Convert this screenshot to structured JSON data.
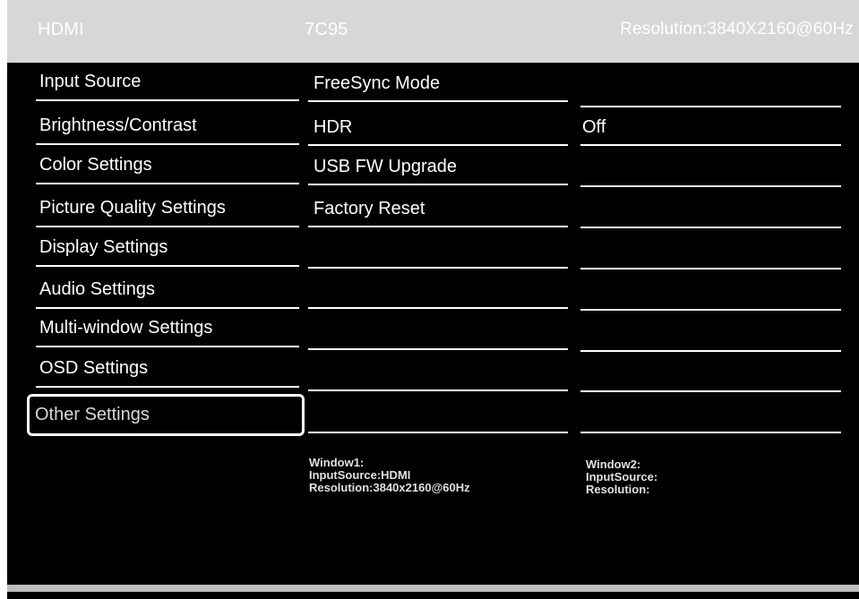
{
  "header": {
    "input_source": "HDMI",
    "model": "7C95",
    "resolution": "Resolution:3840X2160@60Hz"
  },
  "menu": {
    "items": [
      {
        "label": "Input Source"
      },
      {
        "label": "Brightness/Contrast"
      },
      {
        "label": "Color Settings"
      },
      {
        "label": "Picture Quality Settings"
      },
      {
        "label": "Display Settings"
      },
      {
        "label": "Audio Settings"
      },
      {
        "label": "Multi-window Settings"
      },
      {
        "label": "OSD Settings"
      },
      {
        "label": "Other Settings",
        "selected": true
      }
    ]
  },
  "submenu": {
    "items": [
      {
        "label": "FreeSync Mode",
        "value": ""
      },
      {
        "label": "HDR",
        "value": "Off"
      },
      {
        "label": "USB FW Upgrade",
        "value": ""
      },
      {
        "label": "Factory Reset",
        "value": ""
      },
      {
        "label": "",
        "value": ""
      },
      {
        "label": "",
        "value": ""
      },
      {
        "label": "",
        "value": ""
      },
      {
        "label": "",
        "value": ""
      },
      {
        "label": "",
        "value": ""
      }
    ]
  },
  "window1": {
    "title": "Window1:",
    "input_source": "InputSource:HDMI",
    "resolution": "Resolution:3840x2160@60Hz"
  },
  "window2": {
    "title": "Window2:",
    "input_source": "InputSource:",
    "resolution": "Resolution:"
  },
  "colors": {
    "background": "#000000",
    "header": "#d7d7d7",
    "text": "#ffffff",
    "bottom_bar": "#bdbdbd"
  }
}
